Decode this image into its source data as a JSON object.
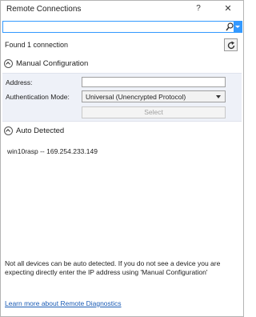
{
  "window": {
    "title": "Remote Connections",
    "help_label": "?",
    "close_label": "✕"
  },
  "search": {
    "value": "",
    "placeholder": "",
    "icon": "search-icon"
  },
  "status": {
    "found_text": "Found 1 connection"
  },
  "manual": {
    "header": "Manual Configuration",
    "address_label": "Address:",
    "address_value": "",
    "auth_label": "Authentication Mode:",
    "auth_value": "Universal (Unencrypted Protocol)",
    "select_label": "Select"
  },
  "auto": {
    "header": "Auto Detected",
    "devices": [
      {
        "label": "win10rasp -- 169.254.233.149"
      }
    ]
  },
  "footer": {
    "info": "Not all devices can be auto detected. If you do not see a device you are expecting directly enter the IP address using 'Manual Configuration'",
    "link": "Learn more about Remote Diagnostics"
  },
  "colors": {
    "accent": "#3399ff",
    "panel_bg": "#eef1f8",
    "link": "#1a5bb5"
  }
}
